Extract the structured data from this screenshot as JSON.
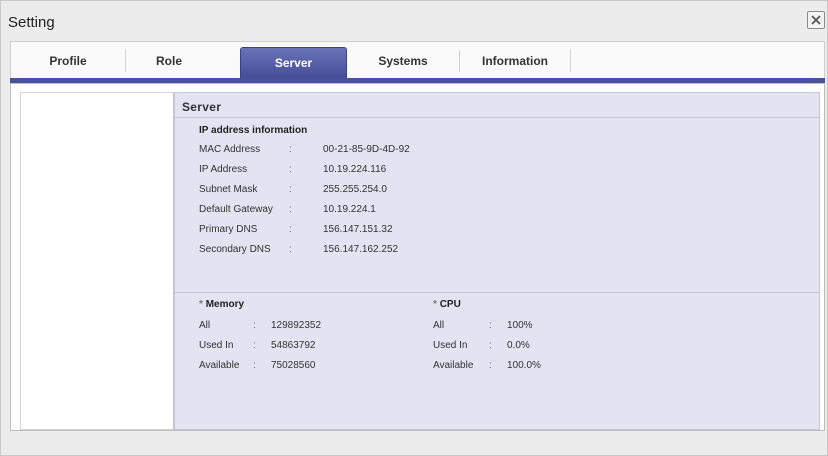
{
  "window": {
    "title": "Setting"
  },
  "tabs": [
    {
      "label": "Profile"
    },
    {
      "label": "Role"
    },
    {
      "label": "Server"
    },
    {
      "label": "Systems"
    },
    {
      "label": "Information"
    }
  ],
  "active_tab": "Server",
  "server": {
    "title": "Server",
    "ip_group": {
      "title": "IP address information",
      "rows": [
        {
          "label": "MAC Address",
          "sep": ":",
          "value": "00-21-85-9D-4D-92"
        },
        {
          "label": "IP Address",
          "sep": ":",
          "value": "10.19.224.116"
        },
        {
          "label": "Subnet Mask",
          "sep": ":",
          "value": "255.255.254.0"
        },
        {
          "label": "Default Gateway",
          "sep": ":",
          "value": "10.19.224.1"
        },
        {
          "label": "Primary DNS",
          "sep": ":",
          "value": "156.147.151.32"
        },
        {
          "label": "Secondary DNS",
          "sep": ":",
          "value": "156.147.162.252"
        }
      ]
    },
    "memory": {
      "star": "*",
      "title": "Memory",
      "rows": [
        {
          "label": "All",
          "sep": ":",
          "value": "129892352"
        },
        {
          "label": "Used In",
          "sep": ":",
          "value": "54863792"
        },
        {
          "label": "Available",
          "sep": ":",
          "value": "75028560"
        }
      ]
    },
    "cpu": {
      "star": "*",
      "title": "CPU",
      "rows": [
        {
          "label": "All",
          "sep": ":",
          "value": "100%"
        },
        {
          "label": "Used In",
          "sep": ":",
          "value": "0.0%"
        },
        {
          "label": "Available",
          "sep": ":",
          "value": "100.0%"
        }
      ]
    }
  },
  "colors": {
    "active_tab": "#4a529a",
    "panel_bg": "#e3e3f2"
  }
}
